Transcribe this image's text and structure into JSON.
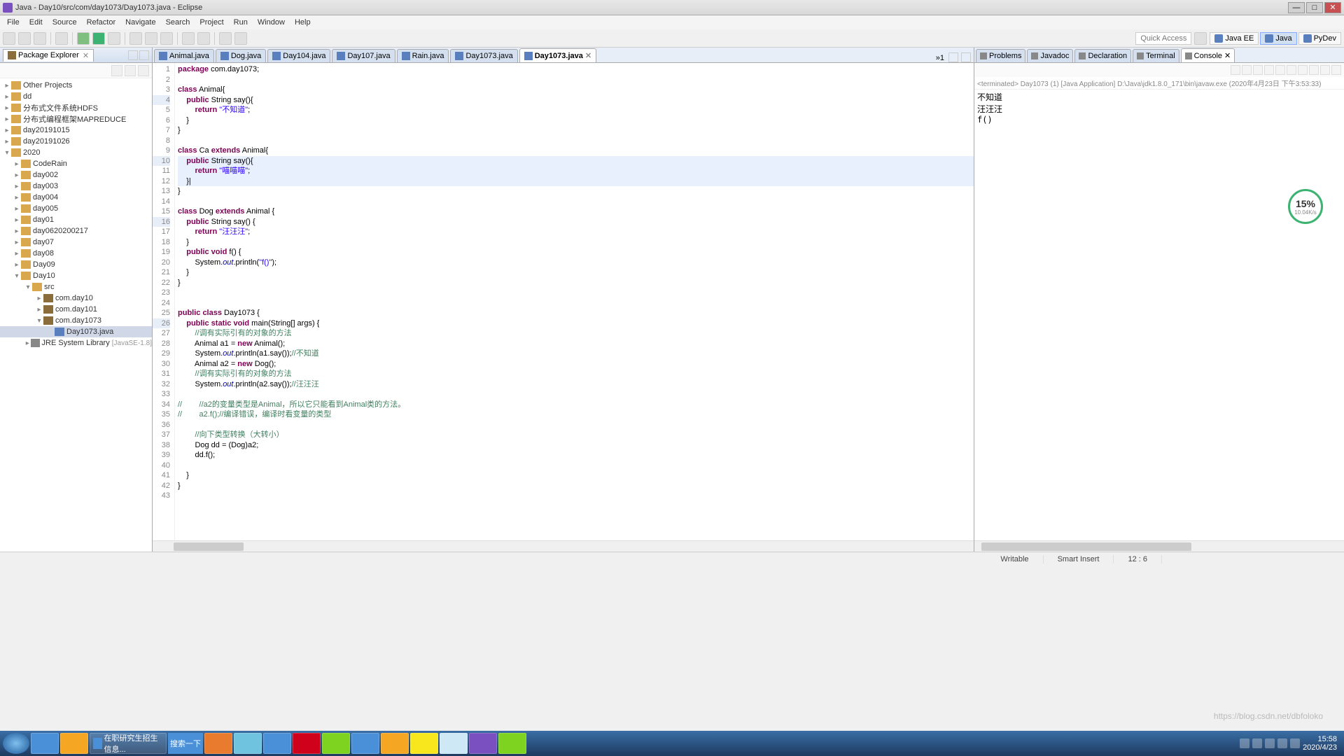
{
  "window": {
    "title": "Java - Day10/src/com/day1073/Day1073.java - Eclipse"
  },
  "menu": [
    "File",
    "Edit",
    "Source",
    "Refactor",
    "Navigate",
    "Search",
    "Project",
    "Run",
    "Window",
    "Help"
  ],
  "quickaccess": "Quick Access",
  "perspectives": [
    {
      "label": "Java EE",
      "active": false
    },
    {
      "label": "Java",
      "active": true
    },
    {
      "label": "PyDev",
      "active": false
    }
  ],
  "leftview": {
    "title": "Package Explorer"
  },
  "tree": [
    {
      "indent": 0,
      "tw": "▸",
      "icon": "proj",
      "label": "Other Projects"
    },
    {
      "indent": 0,
      "tw": "▸",
      "icon": "proj",
      "label": "dd"
    },
    {
      "indent": 0,
      "tw": "▸",
      "icon": "proj",
      "label": "分布式文件系统HDFS"
    },
    {
      "indent": 0,
      "tw": "▸",
      "icon": "proj",
      "label": "分布式编程框架MAPREDUCE"
    },
    {
      "indent": 0,
      "tw": "▸",
      "icon": "proj",
      "label": "day20191015"
    },
    {
      "indent": 0,
      "tw": "▸",
      "icon": "proj",
      "label": "day20191026"
    },
    {
      "indent": 0,
      "tw": "▾",
      "icon": "proj",
      "label": "2020"
    },
    {
      "indent": 1,
      "tw": "▸",
      "icon": "proj",
      "label": "CodeRain"
    },
    {
      "indent": 1,
      "tw": "▸",
      "icon": "proj",
      "label": "day002"
    },
    {
      "indent": 1,
      "tw": "▸",
      "icon": "proj",
      "label": "day003"
    },
    {
      "indent": 1,
      "tw": "▸",
      "icon": "proj",
      "label": "day004"
    },
    {
      "indent": 1,
      "tw": "▸",
      "icon": "proj",
      "label": "day005"
    },
    {
      "indent": 1,
      "tw": "▸",
      "icon": "proj",
      "label": "day01"
    },
    {
      "indent": 1,
      "tw": "▸",
      "icon": "proj",
      "label": "day0620200217"
    },
    {
      "indent": 1,
      "tw": "▸",
      "icon": "proj",
      "label": "day07"
    },
    {
      "indent": 1,
      "tw": "▸",
      "icon": "proj",
      "label": "day08"
    },
    {
      "indent": 1,
      "tw": "▸",
      "icon": "proj",
      "label": "Day09"
    },
    {
      "indent": 1,
      "tw": "▾",
      "icon": "proj",
      "label": "Day10"
    },
    {
      "indent": 2,
      "tw": "▾",
      "icon": "fold",
      "label": "src"
    },
    {
      "indent": 3,
      "tw": "▸",
      "icon": "pkg",
      "label": "com.day10"
    },
    {
      "indent": 3,
      "tw": "▸",
      "icon": "pkg",
      "label": "com.day101"
    },
    {
      "indent": 3,
      "tw": "▾",
      "icon": "pkg",
      "label": "com.day1073"
    },
    {
      "indent": 4,
      "tw": " ",
      "icon": "file",
      "label": "Day1073.java",
      "sel": true
    },
    {
      "indent": 2,
      "tw": "▸",
      "icon": "lib",
      "label": "JRE System Library",
      "deco": "[JavaSE-1.8]"
    }
  ],
  "editor_tabs": [
    {
      "label": "Animal.java",
      "active": false
    },
    {
      "label": "Dog.java",
      "active": false
    },
    {
      "label": "Day104.java",
      "active": false
    },
    {
      "label": "Day107.java",
      "active": false
    },
    {
      "label": "Rain.java",
      "active": false
    },
    {
      "label": "Day1073.java",
      "active": false
    },
    {
      "label": "Day1073.java",
      "active": true
    }
  ],
  "editor_overflow": "»1",
  "right_tabs": [
    {
      "label": "Problems",
      "active": false
    },
    {
      "label": "Javadoc",
      "active": false
    },
    {
      "label": "Declaration",
      "active": false
    },
    {
      "label": "Terminal",
      "active": false
    },
    {
      "label": "Console",
      "active": true
    }
  ],
  "console_status": "<terminated> Day1073 (1) [Java Application] D:\\Java\\jdk1.8.0_171\\bin\\javaw.exe (2020年4月23日 下午3:53:33)",
  "console_output": "不知道\n汪汪汪\nf()",
  "statusbar": {
    "writable": "Writable",
    "insert": "Smart Insert",
    "pos": "12 : 6"
  },
  "float": {
    "big": "15%",
    "small": "10.04K/s"
  },
  "taskbar": {
    "browser_label": "在职研究生招生信息...",
    "search_label": "搜索一下",
    "time": "15:58",
    "date": "2020/4/23"
  },
  "watermark": "https://blog.csdn.net/dbfoloko",
  "code": {
    "lines": [
      {
        "n": 1,
        "html": "<span class=\"kw\">package</span> com.day1073;"
      },
      {
        "n": 2,
        "html": ""
      },
      {
        "n": 3,
        "html": "<span class=\"kw\">class</span> Animal{"
      },
      {
        "n": 4,
        "html": "    <span class=\"kw\">public</span> String say(){",
        "fold": true
      },
      {
        "n": 5,
        "html": "        <span class=\"kw\">return</span> <span class=\"str\">\"不知道\"</span>;"
      },
      {
        "n": 6,
        "html": "    }"
      },
      {
        "n": 7,
        "html": "}"
      },
      {
        "n": 8,
        "html": ""
      },
      {
        "n": 9,
        "html": "<span class=\"kw\">class</span> Ca <span class=\"kw\">extends</span> Animal{"
      },
      {
        "n": 10,
        "html": "    <span class=\"kw\">public</span> String say(){",
        "fold": true,
        "hl": true
      },
      {
        "n": 11,
        "html": "        <span class=\"kw\">return</span> <span class=\"str\">\"喵喵喵\"</span>;",
        "hl": true
      },
      {
        "n": 12,
        "html": "    }|",
        "hl": true
      },
      {
        "n": 13,
        "html": "}"
      },
      {
        "n": 14,
        "html": ""
      },
      {
        "n": 15,
        "html": "<span class=\"kw\">class</span> Dog <span class=\"kw\">extends</span> Animal {"
      },
      {
        "n": 16,
        "html": "    <span class=\"kw\">public</span> String say() {",
        "fold": true
      },
      {
        "n": 17,
        "html": "        <span class=\"kw\">return</span> <span class=\"str\">\"汪汪汪\"</span>;"
      },
      {
        "n": 18,
        "html": "    }"
      },
      {
        "n": 19,
        "html": "    <span class=\"kw\">public void</span> f() {"
      },
      {
        "n": 20,
        "html": "        System.<span class=\"fld\">out</span>.println(<span class=\"str\">\"f()\"</span>);"
      },
      {
        "n": 21,
        "html": "    }"
      },
      {
        "n": 22,
        "html": "}"
      },
      {
        "n": 23,
        "html": ""
      },
      {
        "n": 24,
        "html": ""
      },
      {
        "n": 25,
        "html": "<span class=\"kw\">public class</span> Day1073 {"
      },
      {
        "n": 26,
        "html": "    <span class=\"kw\">public static void</span> main(String[] args) {",
        "fold": true
      },
      {
        "n": 27,
        "html": "        <span class=\"cm\">//调有实际引有的对象的方法</span>"
      },
      {
        "n": 28,
        "html": "        Animal a1 = <span class=\"kw\">new</span> Animal();"
      },
      {
        "n": 29,
        "html": "        System.<span class=\"fld\">out</span>.println(a1.say());<span class=\"cm\">//不知道</span>"
      },
      {
        "n": 30,
        "html": "        Animal a2 = <span class=\"kw\">new</span> Dog();"
      },
      {
        "n": 31,
        "html": "        <span class=\"cm\">//调有实际引有的对象的方法</span>"
      },
      {
        "n": 32,
        "html": "        System.<span class=\"fld\">out</span>.println(a2.say());<span class=\"cm\">//汪汪汪</span>"
      },
      {
        "n": 33,
        "html": ""
      },
      {
        "n": 34,
        "html": "<span class=\"cm\">//        //a2的变量类型是Animal，所以它只能看到Animal类的方法。</span>"
      },
      {
        "n": 35,
        "html": "<span class=\"cm\">//        a2.f();//编译错误，编译时看变量的类型</span>"
      },
      {
        "n": 36,
        "html": ""
      },
      {
        "n": 37,
        "html": "        <span class=\"cm\">//向下类型转换（大转小）</span>"
      },
      {
        "n": 38,
        "html": "        Dog dd = (Dog)a2;"
      },
      {
        "n": 39,
        "html": "        dd.f();"
      },
      {
        "n": 40,
        "html": ""
      },
      {
        "n": 41,
        "html": "    }"
      },
      {
        "n": 42,
        "html": "}"
      },
      {
        "n": 43,
        "html": ""
      }
    ]
  }
}
